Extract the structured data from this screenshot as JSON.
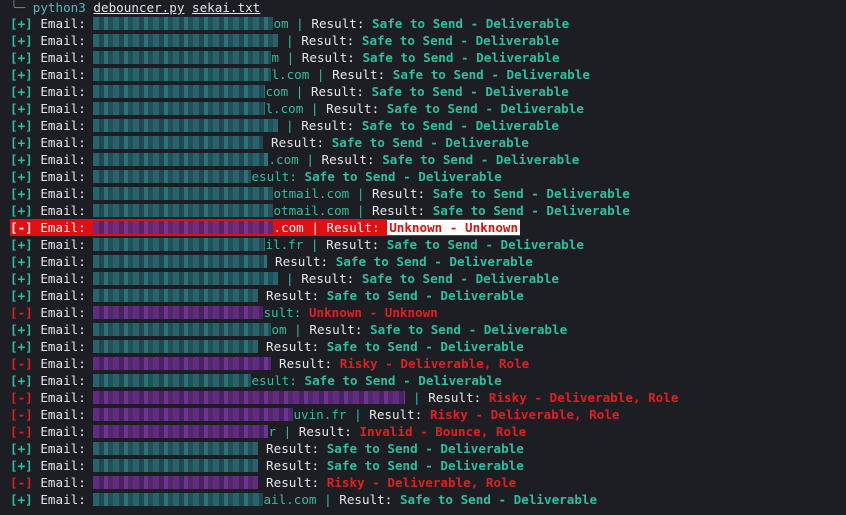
{
  "command": {
    "program": "python3",
    "script": "debouncer.py",
    "file": "sekai.txt"
  },
  "labels": {
    "email": "Email:",
    "result": "Result:"
  },
  "colors": {
    "safe": "#2fbfa0",
    "risky": "#e02020",
    "background": "#1c1e24"
  },
  "rows": [
    {
      "prefix": "[+]",
      "tail": "om | ",
      "status": "Safe to Send - Deliverable",
      "type": "ok"
    },
    {
      "prefix": "[+]",
      "tail": " | ",
      "status": "Safe to Send - Deliverable",
      "type": "ok"
    },
    {
      "prefix": "[+]",
      "tail": "m | ",
      "status": "Safe to Send - Deliverable",
      "type": "ok"
    },
    {
      "prefix": "[+]",
      "tail": "l.com | ",
      "status": "Safe to Send - Deliverable",
      "type": "ok"
    },
    {
      "prefix": "[+]",
      "tail": "com | ",
      "status": "Safe to Send - Deliverable",
      "type": "ok"
    },
    {
      "prefix": "[+]",
      "tail": "l.com | ",
      "status": "Safe to Send - Deliverable",
      "type": "ok"
    },
    {
      "prefix": "[+]",
      "tail": " | ",
      "status": "Safe to Send - Deliverable",
      "type": "ok"
    },
    {
      "prefix": "[+]",
      "tail": " ",
      "status": "Safe to Send - Deliverable",
      "type": "ok"
    },
    {
      "prefix": "[+]",
      "tail": ".com | ",
      "status": "Safe to Send - Deliverable",
      "type": "ok"
    },
    {
      "prefix": "[+]",
      "tail": "esult: ",
      "status": "Safe to Send - Deliverable",
      "type": "ok",
      "nolabel": true
    },
    {
      "prefix": "[+]",
      "tail": "otmail.com | ",
      "status": "Safe to Send - Deliverable",
      "type": "ok"
    },
    {
      "prefix": "[+]",
      "tail": "otmail.com | ",
      "status": "Safe to Send - Deliverable",
      "type": "ok"
    },
    {
      "prefix": "[-]",
      "tail": ".com | ",
      "status": "Unknown - Unknown",
      "type": "bad",
      "highlight": true
    },
    {
      "prefix": "[+]",
      "tail": "il.fr | ",
      "status": "Safe to Send - Deliverable",
      "type": "ok"
    },
    {
      "prefix": "[+]",
      "tail": " ",
      "status": "Safe to Send - Deliverable",
      "type": "ok"
    },
    {
      "prefix": "[+]",
      "tail": " | ",
      "status": "Safe to Send - Deliverable",
      "type": "ok"
    },
    {
      "prefix": "[+]",
      "tail": " ",
      "status": "Safe to Send - Deliverable",
      "type": "ok"
    },
    {
      "prefix": "[-]",
      "tail": "sult: ",
      "status": "Unknown - Unknown",
      "type": "bad",
      "nolabel": true
    },
    {
      "prefix": "[+]",
      "tail": "om | ",
      "status": "Safe to Send - Deliverable",
      "type": "ok"
    },
    {
      "prefix": "[+]",
      "tail": " ",
      "status": "Safe to Send - Deliverable",
      "type": "ok"
    },
    {
      "prefix": "[-]",
      "tail": " ",
      "status": "Risky - Deliverable, Role",
      "type": "bad"
    },
    {
      "prefix": "[+]",
      "tail": "esult: ",
      "status": "Safe to Send - Deliverable",
      "type": "ok",
      "nolabel": true
    },
    {
      "prefix": "[-]",
      "tail": " | ",
      "status": "Risky - Deliverable, Role",
      "type": "bad"
    },
    {
      "prefix": "[-]",
      "tail": "uvin.fr | ",
      "status": "Risky - Deliverable, Role",
      "type": "bad"
    },
    {
      "prefix": "[-]",
      "tail": "r | ",
      "status": "Invalid - Bounce, Role",
      "type": "bad"
    },
    {
      "prefix": "[+]",
      "tail": " ",
      "status": "Safe to Send - Deliverable",
      "type": "ok"
    },
    {
      "prefix": "[+]",
      "tail": " ",
      "status": "Safe to Send - Deliverable",
      "type": "ok"
    },
    {
      "prefix": "[-]",
      "tail": " ",
      "status": "Risky - Deliverable, Role",
      "type": "bad"
    },
    {
      "prefix": "[+]",
      "tail": "ail.com | ",
      "status": "Safe to Send - Deliverable",
      "type": "ok"
    }
  ]
}
